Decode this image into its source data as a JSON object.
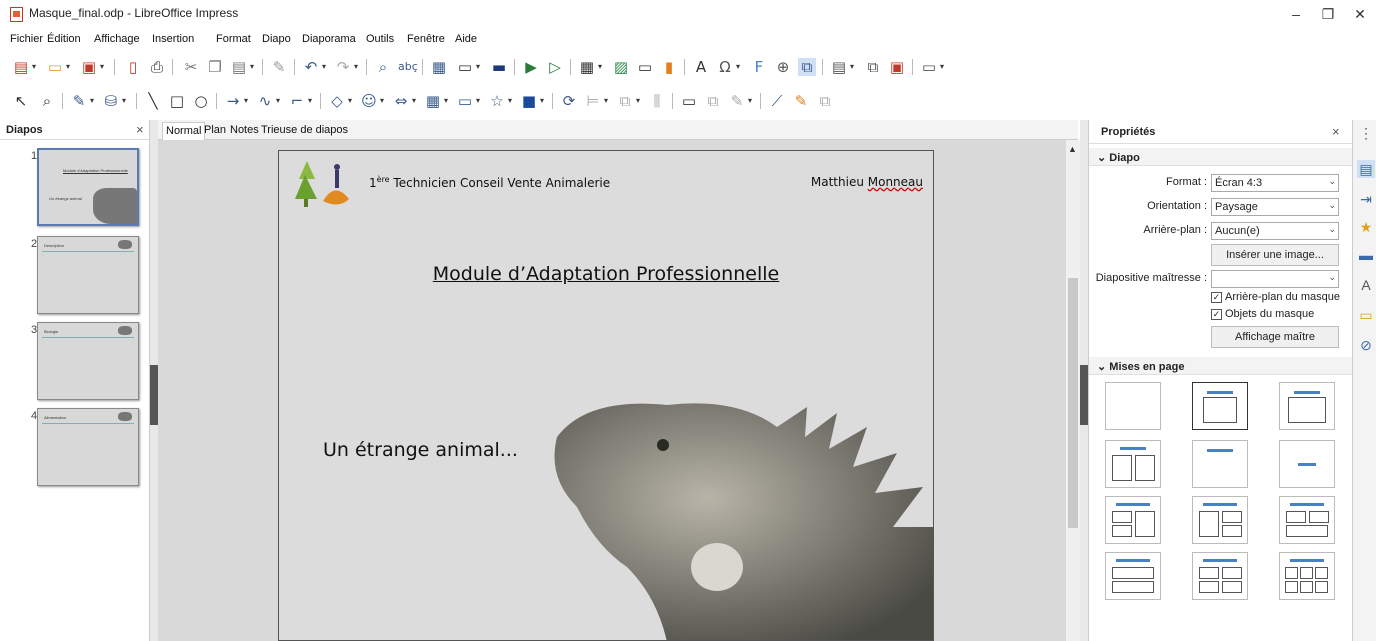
{
  "window": {
    "title": "Masque_final.odp - LibreOffice Impress",
    "controls": [
      "–",
      "❐",
      "✕"
    ]
  },
  "menu": [
    "Fichier",
    "Édition",
    "Affichage",
    "Insertion",
    "Format",
    "Diapo",
    "Diaporama",
    "Outils",
    "Fenêtre",
    "Aide"
  ],
  "slides_panel": {
    "title": "Diapos",
    "close": "×",
    "thumbs": [
      {
        "num": "1",
        "title": "Module d'Adaptation Professionnelle",
        "sub": "Un étrange animal"
      },
      {
        "num": "2",
        "title": "Description",
        "sub": ""
      },
      {
        "num": "3",
        "title": "Biologie",
        "sub": ""
      },
      {
        "num": "4",
        "title": "Alimentation",
        "sub": ""
      }
    ]
  },
  "view_tabs": [
    "Normal",
    "Plan",
    "Notes",
    "Trieuse de diapos"
  ],
  "slide": {
    "header_left_prefix": "1",
    "header_left_sup": "ère",
    "header_left_text": " Technicien Conseil Vente Animalerie",
    "header_right_first": "Matthieu ",
    "header_right_last": "Monneau",
    "title": "Module d’Adaptation Professionnelle",
    "subtitle": "Un étrange animal..."
  },
  "properties": {
    "title": "Propriétés",
    "close": "×",
    "section_diapo": "Diapo",
    "format_label": "Format :",
    "format_value": "Écran 4:3",
    "orientation_label": "Orientation :",
    "orientation_value": "Paysage",
    "background_label": "Arrière-plan :",
    "background_value": "Aucun(e)",
    "insert_image": "Insérer une image...",
    "master_label": "Diapositive maîtresse :",
    "master_value": "",
    "chk_master_bg": "Arrière-plan du masque",
    "chk_master_obj": "Objets du masque",
    "master_view": "Affichage maître",
    "section_layouts": "Mises en page"
  },
  "colors": {
    "accent": "#4a80c8",
    "workspace": "#d9d9d9",
    "slide_bg": "#dcdcdc"
  }
}
